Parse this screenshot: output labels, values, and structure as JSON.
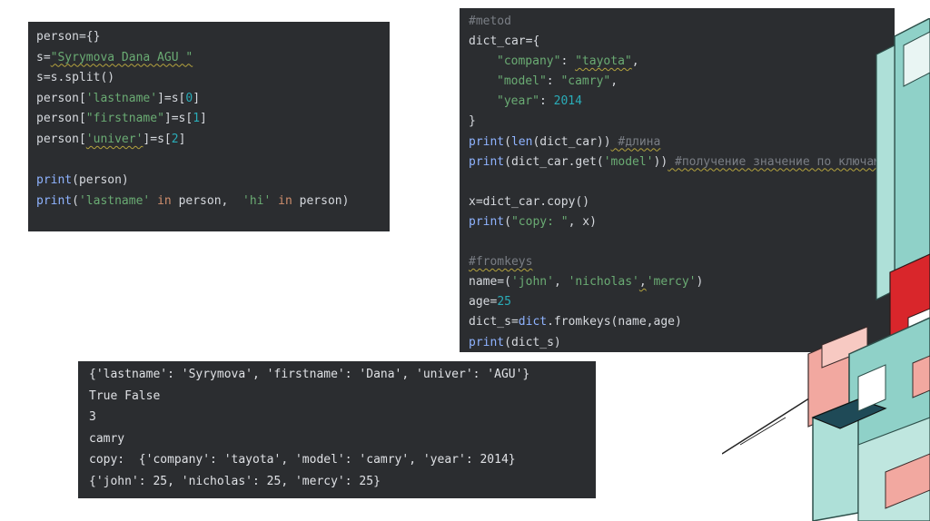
{
  "code_person": {
    "line1": {
      "a": "person={}"
    },
    "line2": {
      "a": "s=",
      "b": "\"Syrymova Dana AGU \""
    },
    "line3": {
      "a": "s=s.split()"
    },
    "line4": {
      "a": "person[",
      "b": "'lastname'",
      "c": "]=s[",
      "d": "0",
      "e": "]"
    },
    "line5": {
      "a": "person[",
      "b": "\"firstname\"",
      "c": "]=s[",
      "d": "1",
      "e": "]"
    },
    "line6": {
      "a": "person[",
      "b": "'univer'",
      "c": "]=s[",
      "d": "2",
      "e": "]"
    },
    "line8": {
      "a": "print",
      "b": "(person)"
    },
    "line9": {
      "a": "print",
      "b": "(",
      "c": "'lastname'",
      "d": " in ",
      "e": "person,  ",
      "f": "'hi'",
      "g": " in ",
      "h": "person)"
    }
  },
  "code_dict": {
    "l1": {
      "a": "#metod"
    },
    "l2": {
      "a": "dict_car={"
    },
    "l3": {
      "a": "\"company\"",
      "b": ": ",
      "c": "\"tayota\"",
      "d": ","
    },
    "l4": {
      "a": "\"model\"",
      "b": ": ",
      "c": "\"camry\"",
      "d": ","
    },
    "l5": {
      "a": "\"year\"",
      "b": ": ",
      "c": "2014"
    },
    "l6": {
      "a": "}"
    },
    "l7": {
      "a": "print",
      "b": "(",
      "c": "len",
      "d": "(dict_car))",
      "e": " #длина"
    },
    "l8": {
      "a": "print",
      "b": "(dict_car.get(",
      "c": "'model'",
      "d": "))",
      "e": " #получение значение по ключам"
    },
    "l10": {
      "a": "x=dict_car.copy()"
    },
    "l11": {
      "a": "print",
      "b": "(",
      "c": "\"copy: \"",
      "d": ", x)"
    },
    "l13": {
      "a": "#fromkeys"
    },
    "l14": {
      "a": "name=(",
      "b": "'john'",
      "c": ", ",
      "d": "'nicholas'",
      "e": ",",
      "f": "'mercy'",
      "g": ")"
    },
    "l15": {
      "a": "age=",
      "b": "25"
    },
    "l16": {
      "a": "dict_s=",
      "b": "dict",
      "c": ".fromkeys(name,age)"
    },
    "l17": {
      "a": "print",
      "b": "(dict_s)"
    }
  },
  "output": {
    "lines": [
      "{'lastname': 'Syrymova', 'firstname': 'Dana', 'univer': 'AGU'}",
      "True False",
      "3",
      "camry",
      "copy:  {'company': 'tayota', 'model': 'camry', 'year': 2014}",
      "{'john': 25, 'nicholas': 25, 'mercy': 25}"
    ]
  },
  "colors": {
    "panel_bg": "#2b2d30",
    "string": "#6aab73",
    "keyword": "#cf8e6d",
    "builtin": "#8fb3ff",
    "number": "#2aacb8",
    "comment": "#7a7e85",
    "deco_teal": "#8fd1c8",
    "deco_red": "#d9262b",
    "deco_pink": "#f2a8a0"
  }
}
